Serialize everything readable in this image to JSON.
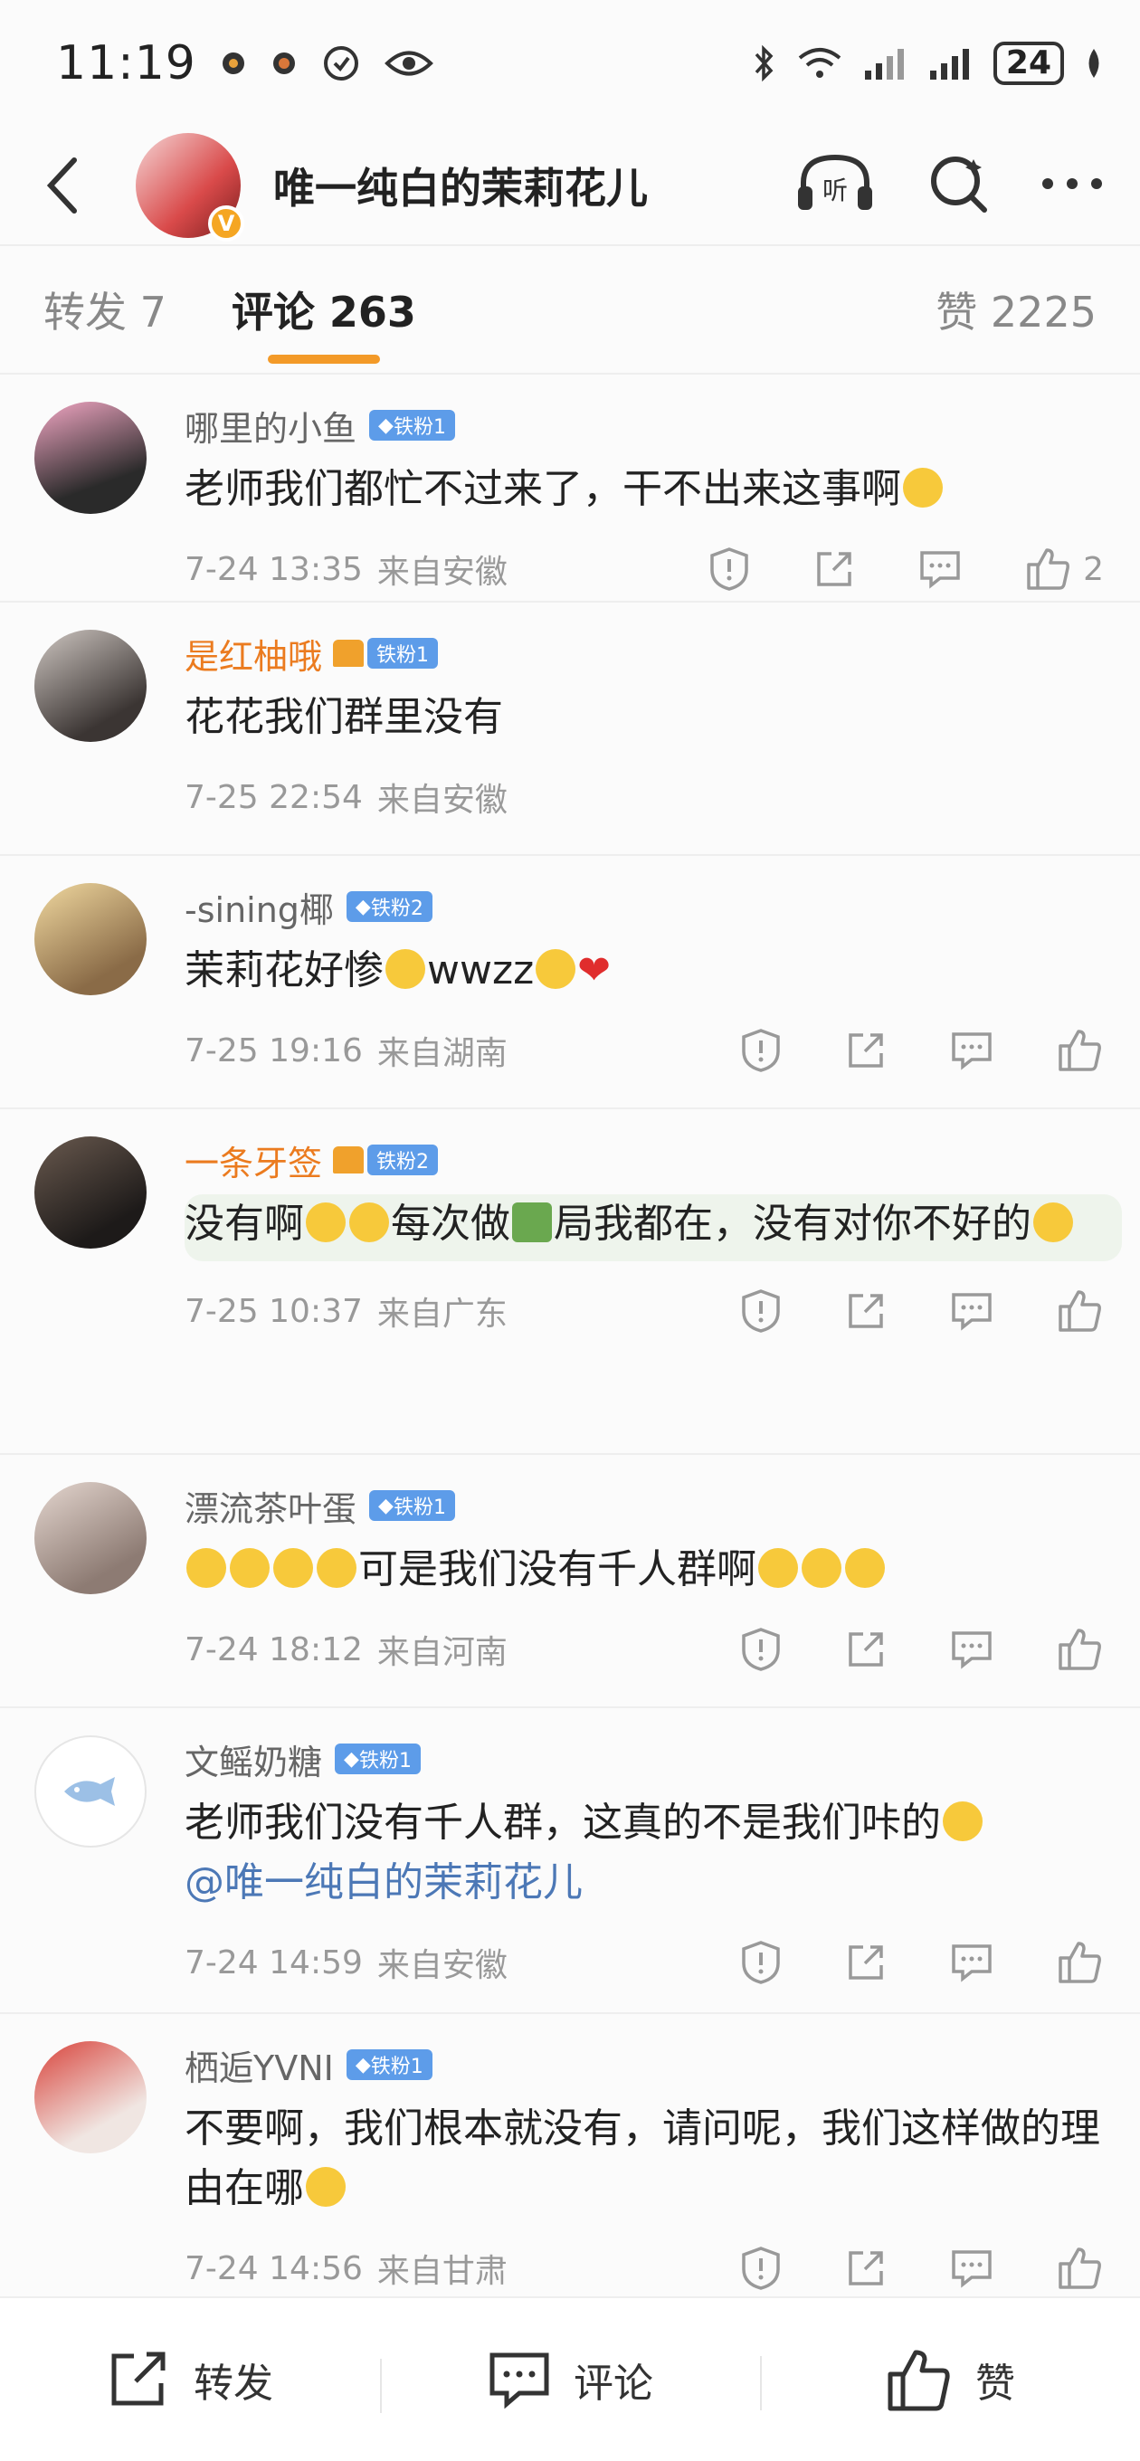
{
  "status_bar": {
    "time": "11:19",
    "battery": "24"
  },
  "header": {
    "title": "唯一纯白的茉莉花儿",
    "verified": "V"
  },
  "tabs": [
    {
      "label": "转发 7"
    },
    {
      "label": "评论 263"
    },
    {
      "label": "赞 2225"
    }
  ],
  "comments": [
    {
      "name": "哪里的小鱼",
      "badge": "铁粉1",
      "text": "老师我们都忙不过来了，干不出来这事啊",
      "time": "7-24 13:35",
      "location": "来自安徽",
      "likes": "2"
    },
    {
      "name": "是红柚哦",
      "badge": "铁粉1",
      "text": "花花我们群里没有",
      "time": "7-25 22:54",
      "location": "来自安徽",
      "likes": ""
    },
    {
      "name": "-sining椰",
      "badge": "铁粉2",
      "text": "茉莉花好惨",
      "text2": "wwzz",
      "time": "7-25 19:16",
      "location": "来自湖南",
      "likes": ""
    },
    {
      "name": "一条牙签",
      "badge": "铁粉2",
      "text_a": "没有啊",
      "text_b": "每次做",
      "text_c": "局我都在，没有对你不好的",
      "time": "7-25 10:37",
      "location": "来自广东",
      "likes": ""
    },
    {
      "name": "漂流茶叶蛋",
      "badge": "铁粉1",
      "text": "可是我们没有千人群啊",
      "time": "7-24 18:12",
      "location": "来自河南",
      "likes": ""
    },
    {
      "name": "文鳐奶糖",
      "badge": "铁粉1",
      "text": "老师我们没有千人群，这真的不是我们咔的",
      "mention": "@唯一纯白的茉莉花儿",
      "time": "7-24 14:59",
      "location": "来自安徽",
      "likes": ""
    },
    {
      "name": "栖逅YVNI",
      "badge": "铁粉1",
      "text": "不要啊，我们根本就没有，请问呢，我们这样做的理由在哪",
      "time": "7-24 14:56",
      "location": "来自甘肃",
      "likes": ""
    }
  ],
  "bottom_bar": {
    "repost": "转发",
    "comment": "评论",
    "like": "赞"
  }
}
